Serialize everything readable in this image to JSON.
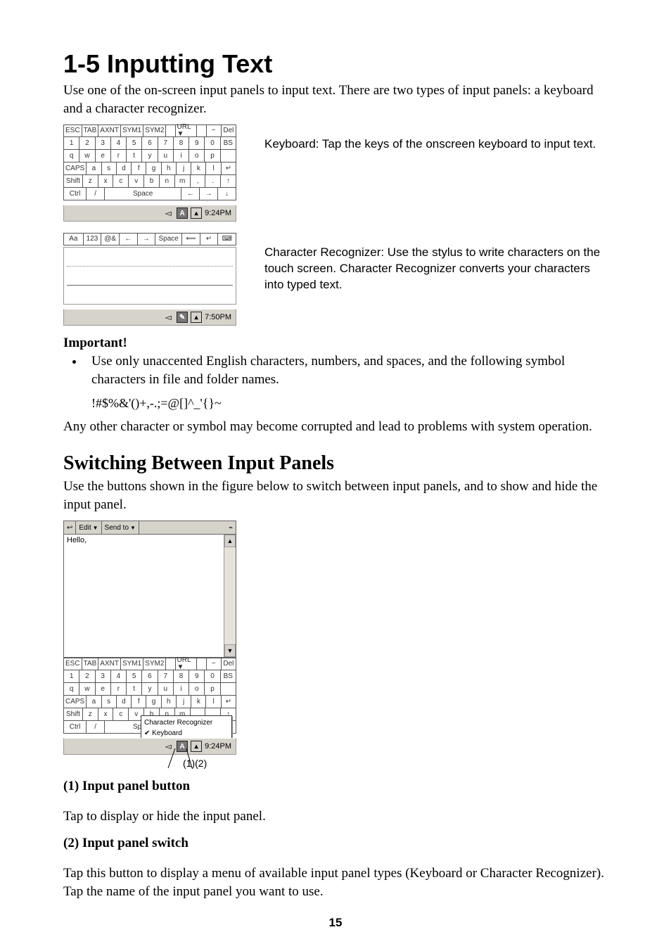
{
  "h1": "1-5 Inputting Text",
  "intro": "Use one of the on-screen input panels to input text. There are two types of input panels: a keyboard and a character recognizer.",
  "keyboard_desc": "Keyboard: Tap the keys of the onscreen keyboard to input text.",
  "recognizer_desc": "Character Recognizer: Use the stylus to write characters on the touch screen. Character Recognizer converts your characters into typed text.",
  "important_label": "Important!",
  "important_bullet": "Use only unaccented English characters, numbers, and spaces, and the following symbol characters in file and folder names.",
  "symbols": "!#$%&'()+,-.;=@[]^_'{}~",
  "important_after": "Any other character or symbol may become corrupted and lead to problems with system operation.",
  "h2": "Switching Between Input Panels",
  "switch_intro": "Use the buttons shown in the figure below to switch between input panels, and to show and hide the input panel.",
  "defn1_head": "(1) Input panel button",
  "defn1_body": "Tap to display or hide the input panel.",
  "defn2_head": "(2) Input panel switch",
  "defn2_body": "Tap this button to display a menu of available input panel types (Keyboard or Character Recognizer). Tap the name of the input panel you want to use.",
  "page_num": "15",
  "kbd": {
    "row1": [
      "ESC",
      "TAB",
      "AXNT",
      "SYM1",
      "SYM2",
      "",
      "URL ▼",
      "",
      "−",
      "Del"
    ],
    "row2": [
      "1",
      "2",
      "3",
      "4",
      "5",
      "6",
      "7",
      "8",
      "9",
      "0",
      "BS"
    ],
    "row3": [
      "q",
      "w",
      "e",
      "r",
      "t",
      "y",
      "u",
      "i",
      "o",
      "p",
      ""
    ],
    "row4": [
      "CAPS",
      "a",
      "s",
      "d",
      "f",
      "g",
      "h",
      "j",
      "k",
      "l",
      "↵"
    ],
    "row5": [
      "Shift",
      "z",
      "x",
      "c",
      "v",
      "b",
      "n",
      "m",
      ",",
      ".",
      "↑"
    ],
    "row6": [
      "Ctrl",
      "/",
      "Space",
      "←",
      "→",
      "↓"
    ],
    "time": "9:24PM"
  },
  "rec": {
    "modes": [
      "Aa",
      "123",
      "@&",
      "←",
      "→",
      "Space",
      "⟸",
      "↵",
      "⌨"
    ],
    "time": "7:50PM"
  },
  "shot2": {
    "edit": "Edit",
    "send": "Send to",
    "body_text": "Hello,",
    "menu": {
      "item1": "Character Recognizer",
      "item2": "Keyboard"
    },
    "time": "9:24PM",
    "callout1": "(1)",
    "callout2": "(2)"
  }
}
